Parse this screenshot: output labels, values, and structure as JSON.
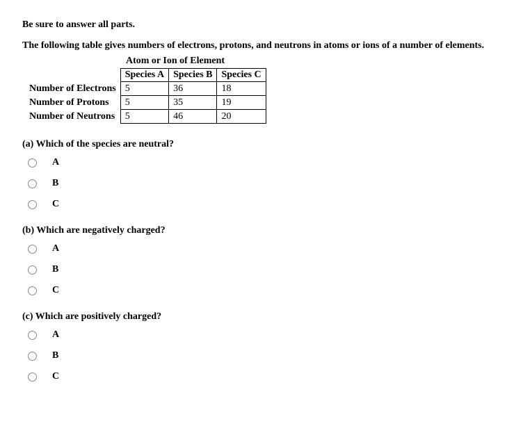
{
  "intro": {
    "line1": "Be sure to answer all parts.",
    "line2": "The following table gives numbers of electrons, protons, and neutrons in atoms or ions of a number of elements."
  },
  "table": {
    "caption": "Atom or Ion of Element",
    "col_headers": [
      "Species A",
      "Species B",
      "Species C"
    ],
    "rows": [
      {
        "label": "Number of Electrons",
        "values": [
          "5",
          "36",
          "18"
        ]
      },
      {
        "label": "Number of Protons",
        "values": [
          "5",
          "35",
          "19"
        ]
      },
      {
        "label": "Number of Neutrons",
        "values": [
          "5",
          "46",
          "20"
        ]
      }
    ]
  },
  "questions": [
    {
      "prompt": "(a) Which of the species are neutral?",
      "options": [
        "A",
        "B",
        "C"
      ]
    },
    {
      "prompt": "(b) Which are negatively charged?",
      "options": [
        "A",
        "B",
        "C"
      ]
    },
    {
      "prompt": "(c) Which are positively charged?",
      "options": [
        "A",
        "B",
        "C"
      ]
    }
  ]
}
